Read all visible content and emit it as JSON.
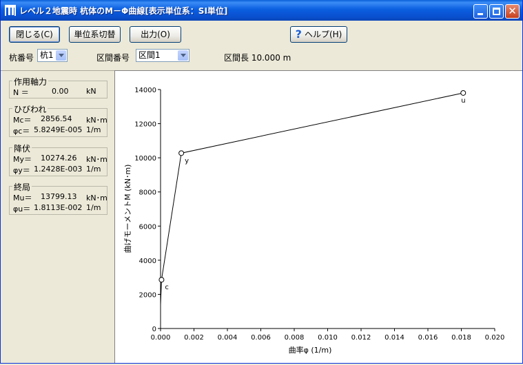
{
  "window": {
    "title": "レベル２地震時  杭体のM－Φ曲線[表示単位系：SI単位]",
    "minimize_label": "minimize-icon",
    "maximize_label": "maximize-icon",
    "close_label": "close-icon"
  },
  "toolbar": {
    "close_button": "閉じる(C)",
    "unit_toggle_button": "単位系切替",
    "output_button": "出力(O)",
    "help_button": "ヘルプ(H)",
    "pile_label": "杭番号",
    "pile_value": "杭1",
    "section_label": "区間番号",
    "section_value": "区間1",
    "section_length_label": "区間長",
    "section_length_value": "10.000",
    "section_length_unit": "m"
  },
  "panel": {
    "axial": {
      "title": "作用軸力",
      "n_label": "N ＝",
      "n_value": "0.00",
      "n_unit": "kN"
    },
    "crack": {
      "title": "ひびわれ",
      "m_label": "Mc＝",
      "m_value": "2856.54",
      "m_unit": "kN･m",
      "phi_label": "φc＝",
      "phi_value": "5.8249E-005",
      "phi_unit": "1/m"
    },
    "yield": {
      "title": "降伏",
      "m_label": "My＝",
      "m_value": "10274.26",
      "m_unit": "kN･m",
      "phi_label": "φy＝",
      "phi_value": "1.2428E-003",
      "phi_unit": "1/m"
    },
    "ultimate": {
      "title": "終局",
      "m_label": "Mu＝",
      "m_value": "13799.13",
      "m_unit": "kN･m",
      "phi_label": "φu＝",
      "phi_value": "1.8113E-002",
      "phi_unit": "1/m"
    }
  },
  "chart_data": {
    "type": "line",
    "xlabel": "曲率φ (1/m)",
    "ylabel": "曲げモーメントM (kN･m)",
    "xlim": [
      0,
      0.02
    ],
    "ylim": [
      0,
      14000
    ],
    "x_ticks": [
      "0.000",
      "0.002",
      "0.004",
      "0.006",
      "0.008",
      "0.010",
      "0.012",
      "0.014",
      "0.016",
      "0.018",
      "0.020"
    ],
    "y_ticks": [
      "0",
      "2000",
      "4000",
      "6000",
      "8000",
      "10000",
      "12000",
      "14000"
    ],
    "grid": false,
    "series": [
      {
        "x": [
          0,
          5.8249e-05,
          0.0012428,
          0.018113
        ],
        "y": [
          1400,
          2856.54,
          10274.26,
          13799.13
        ]
      }
    ],
    "points": [
      {
        "label": "c",
        "x": 5.8249e-05,
        "y": 2856.54
      },
      {
        "label": "y",
        "x": 0.0012428,
        "y": 10274.26
      },
      {
        "label": "u",
        "x": 0.018113,
        "y": 13799.13
      }
    ],
    "line_color": "#000000"
  }
}
